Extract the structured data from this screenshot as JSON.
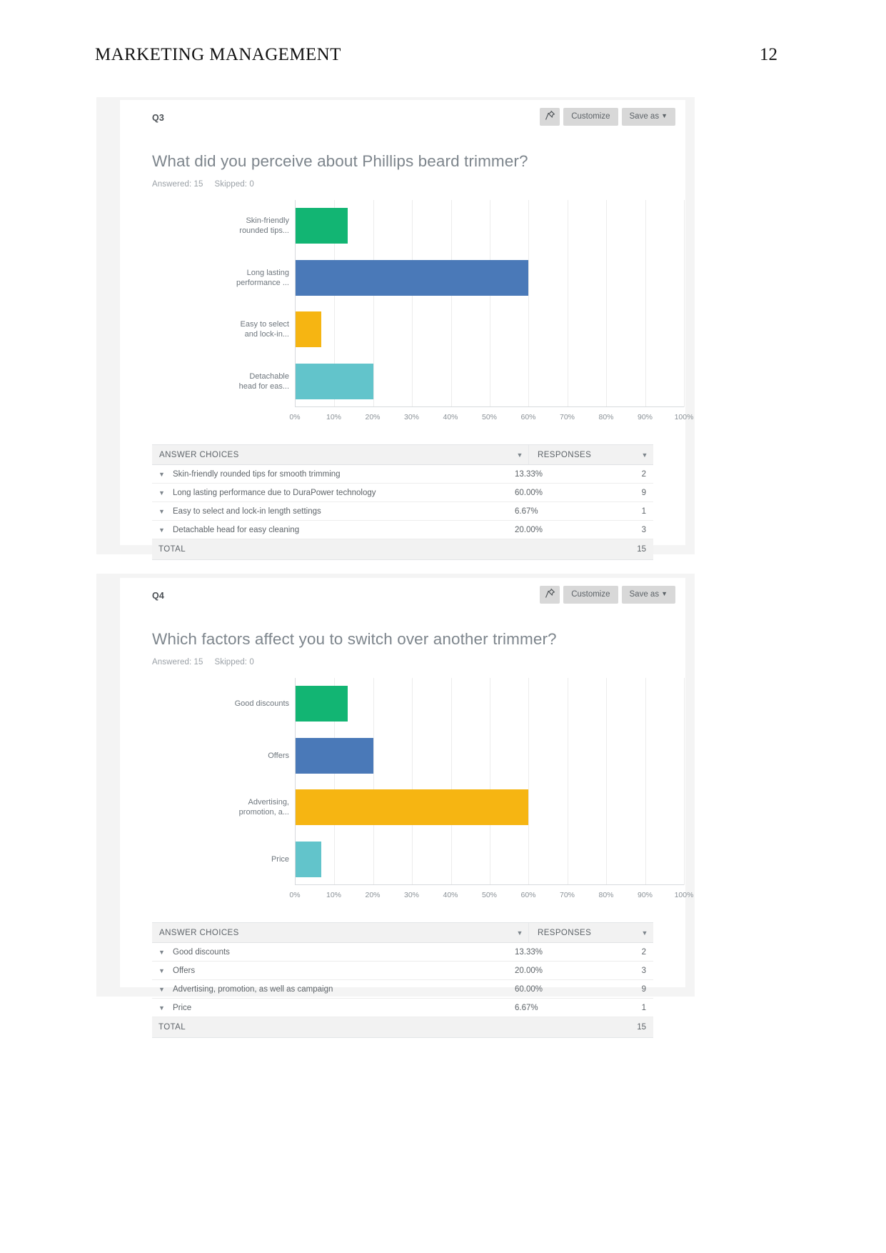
{
  "document": {
    "header_title": "MARKETING MANAGEMENT",
    "page_number": "12"
  },
  "cards": [
    {
      "q_label": "Q3",
      "question": "What did you perceive about Phillips beard trimmer?",
      "answered_label": "Answered: 15",
      "skipped_label": "Skipped: 0",
      "buttons": {
        "pin_icon": "pin-icon",
        "customize": "Customize",
        "save_as": "Save as",
        "caret": "▼"
      },
      "table": {
        "col_choices": "ANSWER CHOICES",
        "col_responses": "RESPONSES",
        "total_label": "TOTAL",
        "total_value": "15",
        "rows": [
          {
            "choice": "Skin-friendly rounded tips for smooth trimming",
            "percent": "13.33%",
            "count": "2"
          },
          {
            "choice": "Long lasting performance due to DuraPower technology",
            "percent": "60.00%",
            "count": "9"
          },
          {
            "choice": "Easy to select and lock-in length settings",
            "percent": "6.67%",
            "count": "1"
          },
          {
            "choice": "Detachable head for easy cleaning",
            "percent": "20.00%",
            "count": "3"
          }
        ]
      },
      "chart_data": {
        "type": "bar",
        "orientation": "horizontal",
        "title": "What did you perceive about Phillips beard trimmer?",
        "categories": [
          "Skin-friendly\nrounded tips...",
          "Long lasting\nperformance ...",
          "Easy to select\nand lock-in...",
          "Detachable\nhead for eas..."
        ],
        "values": [
          13.33,
          60.0,
          6.67,
          20.0
        ],
        "counts": [
          2,
          9,
          1,
          3
        ],
        "colors": [
          "#12b573",
          "#4a79b8",
          "#f6b512",
          "#62c4cb"
        ],
        "xlabel": "",
        "ylabel": "",
        "xlim": [
          0,
          100
        ],
        "xticks": [
          "0%",
          "10%",
          "20%",
          "30%",
          "40%",
          "50%",
          "60%",
          "70%",
          "80%",
          "90%",
          "100%"
        ],
        "grid": true,
        "legend": "none"
      }
    },
    {
      "q_label": "Q4",
      "question": "Which factors affect you to switch over another trimmer?",
      "answered_label": "Answered: 15",
      "skipped_label": "Skipped: 0",
      "buttons": {
        "pin_icon": "pin-icon",
        "customize": "Customize",
        "save_as": "Save as",
        "caret": "▼"
      },
      "table": {
        "col_choices": "ANSWER CHOICES",
        "col_responses": "RESPONSES",
        "total_label": "TOTAL",
        "total_value": "15",
        "rows": [
          {
            "choice": "Good discounts",
            "percent": "13.33%",
            "count": "2"
          },
          {
            "choice": "Offers",
            "percent": "20.00%",
            "count": "3"
          },
          {
            "choice": "Advertising, promotion, as well as campaign",
            "percent": "60.00%",
            "count": "9"
          },
          {
            "choice": "Price",
            "percent": "6.67%",
            "count": "1"
          }
        ]
      },
      "chart_data": {
        "type": "bar",
        "orientation": "horizontal",
        "title": "Which factors affect you to switch over another trimmer?",
        "categories": [
          "Good discounts",
          "Offers",
          "Advertising,\npromotion, a...",
          "Price"
        ],
        "values": [
          13.33,
          20.0,
          60.0,
          6.67
        ],
        "counts": [
          2,
          3,
          9,
          1
        ],
        "colors": [
          "#12b573",
          "#4a79b8",
          "#f6b512",
          "#62c4cb"
        ],
        "xlabel": "",
        "ylabel": "",
        "xlim": [
          0,
          100
        ],
        "xticks": [
          "0%",
          "10%",
          "20%",
          "30%",
          "40%",
          "50%",
          "60%",
          "70%",
          "80%",
          "90%",
          "100%"
        ],
        "grid": true,
        "legend": "none"
      }
    }
  ]
}
